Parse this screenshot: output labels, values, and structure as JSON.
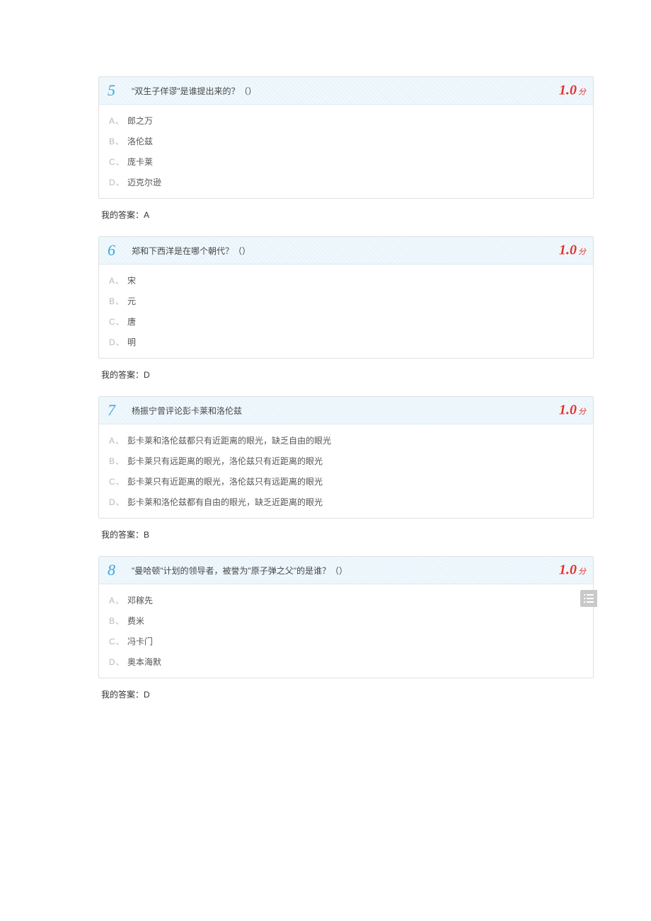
{
  "score_suffix": "分",
  "answer_prefix": "我的答案：",
  "questions": [
    {
      "number": "5",
      "text": "\"双生子佯谬\"是谁提出来的？（）",
      "score": "1.0",
      "options": [
        {
          "label": "A、",
          "text": "郎之万"
        },
        {
          "label": "B、",
          "text": "洛伦兹"
        },
        {
          "label": "C、",
          "text": "庞卡莱"
        },
        {
          "label": "D、",
          "text": "迈克尔逊"
        }
      ],
      "my_answer": "A"
    },
    {
      "number": "6",
      "text": "郑和下西洋是在哪个朝代？（）",
      "score": "1.0",
      "options": [
        {
          "label": "A、",
          "text": "宋"
        },
        {
          "label": "B、",
          "text": "元"
        },
        {
          "label": "C、",
          "text": "唐"
        },
        {
          "label": "D、",
          "text": "明"
        }
      ],
      "my_answer": "D"
    },
    {
      "number": "7",
      "text": "杨振宁曾评论彭卡莱和洛伦兹",
      "score": "1.0",
      "options": [
        {
          "label": "A、",
          "text": "彭卡莱和洛伦兹都只有近距离的眼光，缺乏自由的眼光"
        },
        {
          "label": "B、",
          "text": "彭卡莱只有远距离的眼光，洛伦兹只有近距离的眼光"
        },
        {
          "label": "C、",
          "text": "彭卡莱只有近距离的眼光，洛伦兹只有远距离的眼光"
        },
        {
          "label": "D、",
          "text": "彭卡莱和洛伦兹都有自由的眼光，缺乏近距离的眼光"
        }
      ],
      "my_answer": "B"
    },
    {
      "number": "8",
      "text": "\"曼哈顿\"计划的领导者，被誉为\"原子弹之父\"的是谁？（）",
      "score": "1.0",
      "options": [
        {
          "label": "A、",
          "text": "邓稼先"
        },
        {
          "label": "B、",
          "text": "费米"
        },
        {
          "label": "C、",
          "text": "冯卡门"
        },
        {
          "label": "D、",
          "text": "奥本海默"
        }
      ],
      "my_answer": "D"
    }
  ]
}
